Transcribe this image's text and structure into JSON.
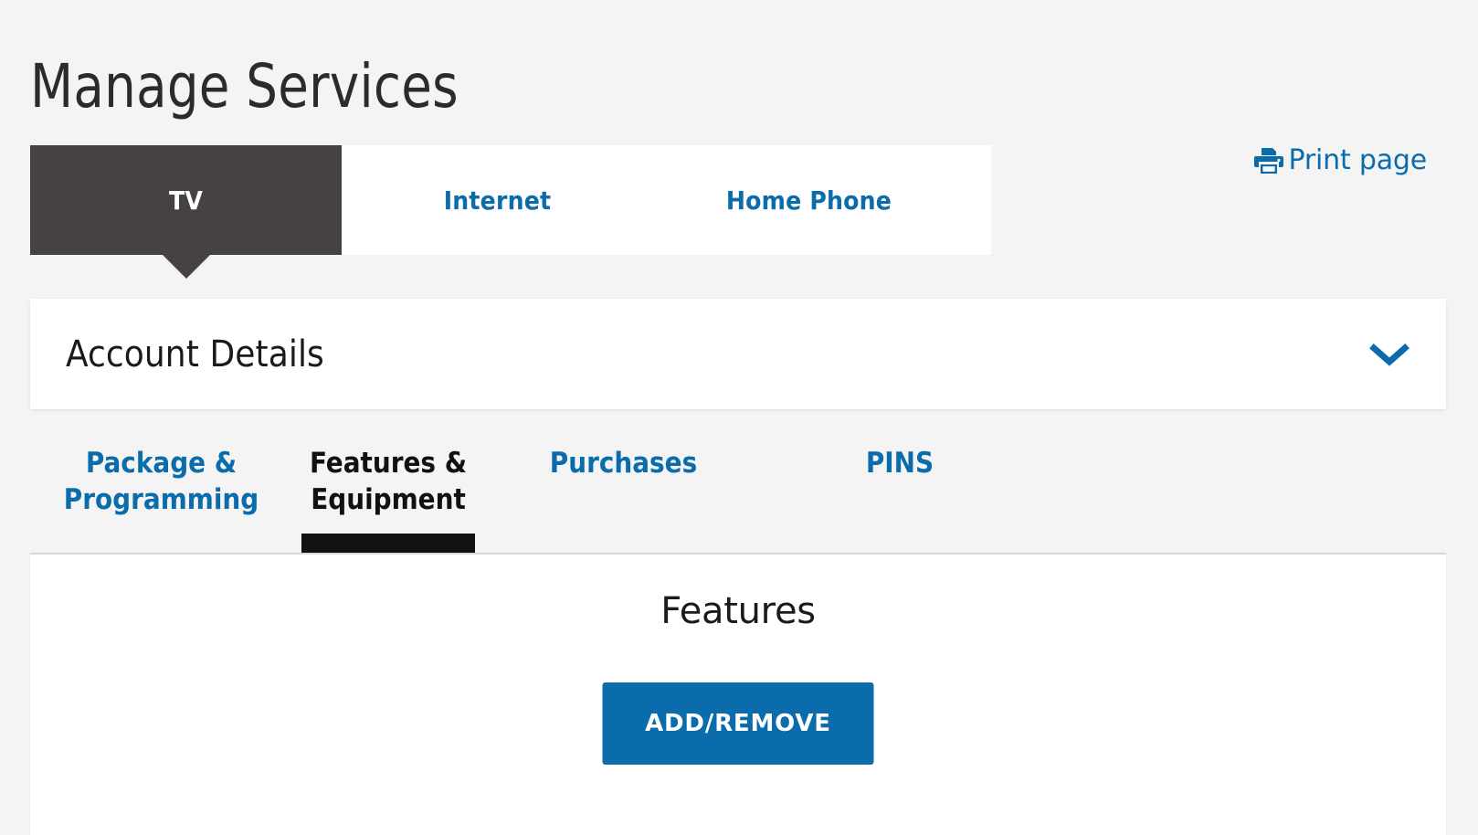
{
  "page": {
    "title": "Manage Services",
    "background_color": "#f4f4f4",
    "accent_color": "#0b6cab",
    "active_tab_color": "#454241"
  },
  "print": {
    "label": "Print page",
    "icon": "printer-icon"
  },
  "service_tabs": [
    {
      "label": "TV",
      "active": true
    },
    {
      "label": "Internet",
      "active": false
    },
    {
      "label": "Home Phone",
      "active": false
    }
  ],
  "account_details": {
    "title": "Account Details",
    "expanded": false,
    "chevron_icon": "chevron-down-icon"
  },
  "sub_tabs": [
    {
      "label": "Package &\nProgramming",
      "active": false
    },
    {
      "label": "Features &\nEquipment",
      "active": true
    },
    {
      "label": "Purchases",
      "active": false
    },
    {
      "label": "PINS",
      "active": false
    }
  ],
  "content": {
    "heading": "Features",
    "primary_button": "ADD/REMOVE"
  }
}
